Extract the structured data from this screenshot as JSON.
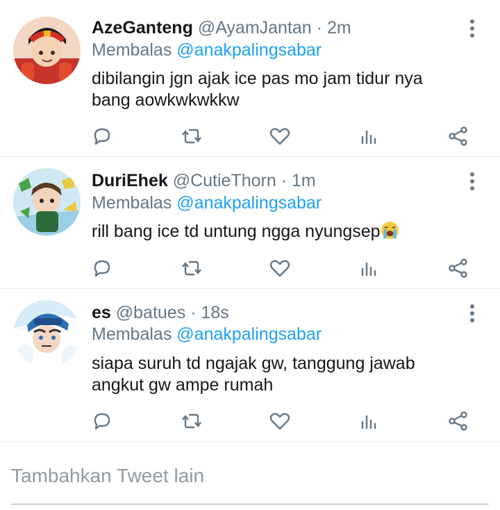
{
  "tweets": [
    {
      "display_name": "AzeGanteng",
      "handle": "@AyamJantan",
      "separator": "·",
      "time": "2m",
      "reply_prefix": "Membalas",
      "reply_to": "@anakpalingsabar",
      "text": "dibilangin jgn ajak ice pas mo jam tidur nya bang aowkwkwkkw"
    },
    {
      "display_name": "DuriEhek",
      "handle": "@CutieThorn",
      "separator": "·",
      "time": "1m",
      "reply_prefix": "Membalas",
      "reply_to": "@anakpalingsabar",
      "text": "rill bang ice td untung ngga nyungsep",
      "emoji": "crying-face"
    },
    {
      "display_name": "es",
      "handle": "@batues",
      "separator": "·",
      "time": "18s",
      "reply_prefix": "Membalas",
      "reply_to": "@anakpalingsabar",
      "text": "siapa suruh td ngajak gw, tanggung jawab angkut gw ampe rumah"
    }
  ],
  "action_icons": [
    "reply-icon",
    "retweet-icon",
    "like-icon",
    "analytics-icon",
    "share-icon"
  ],
  "compose": {
    "placeholder": "Tambahkan Tweet lain"
  },
  "colors": {
    "text": "#14171a",
    "secondary": "#657786",
    "link": "#1da1f2",
    "divider": "#e6ecf0"
  }
}
